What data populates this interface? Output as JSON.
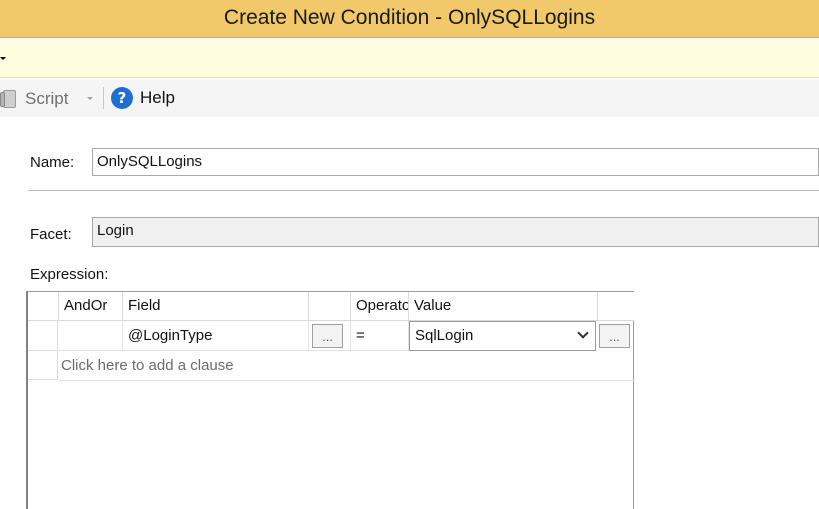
{
  "window": {
    "title": "Create New Condition - OnlySQLLogins"
  },
  "toolbar": {
    "script_label": "Script",
    "help_label": "Help",
    "icons": {
      "script": "script-icon",
      "help": "help-icon",
      "dropdown": "chevron-down-icon"
    }
  },
  "form": {
    "name_label": "Name:",
    "name_value": "OnlySQLLogins",
    "facet_label": "Facet:",
    "facet_value": "Login",
    "expression_label": "Expression:"
  },
  "expression_grid": {
    "columns": [
      "AndOr",
      "Field",
      "",
      "Operator",
      "Value",
      ""
    ],
    "rows": [
      {
        "andor": "",
        "field": "@LoginType",
        "field_button": "...",
        "operator": "=",
        "value": "SqlLogin",
        "value_button": "..."
      }
    ],
    "add_clause_text": "Click here to add a clause"
  },
  "colors": {
    "titlebar": "#f1c86a",
    "infobar": "#fffde0",
    "help_icon": "#1f6fd1"
  }
}
